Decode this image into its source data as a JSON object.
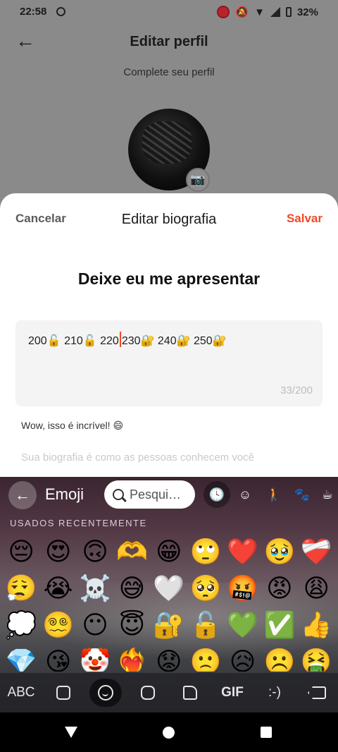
{
  "status_bar": {
    "time": "22:58",
    "battery": "32%"
  },
  "page": {
    "title": "Editar perfil",
    "subtitle": "Complete seu perfil"
  },
  "sheet": {
    "cancel_label": "Cancelar",
    "title": "Editar biografia",
    "save_label": "Salvar",
    "heading": "Deixe eu me apresentar",
    "bio_before_cursor": "200🔓 210🔓 220",
    "bio_after_cursor": "230🔐 240🔐 250🔐",
    "counter": "33/200",
    "tip": "Wow, isso é incrível! 😄",
    "hint": "Sua biografia é como as pessoas conhecem você"
  },
  "keyboard": {
    "mode_label": "Emoji",
    "search_placeholder": "Pesqui…",
    "recent_label": "USADOS RECENTEMENTE",
    "emojis": [
      "😔",
      "😍",
      "🙃",
      "🫶",
      "😁",
      "🙄",
      "❤️",
      "🥹",
      "❤️‍🩹",
      "😮‍💨",
      "😭",
      "☠️",
      "😅",
      "🤍",
      "🥺",
      "🤬",
      "😡",
      "😩",
      "💭",
      "😵‍💫",
      "😶",
      "😇",
      "🔐",
      "🔓",
      "💚",
      "✅",
      "👍",
      "💎",
      "😘",
      "🤡",
      "❤️‍🔥",
      "😟",
      "🙁",
      "😥",
      "☹️",
      "🤮"
    ],
    "bottom": {
      "abc": "ABC",
      "gif": "GIF",
      "emoticon": ":-)"
    }
  }
}
